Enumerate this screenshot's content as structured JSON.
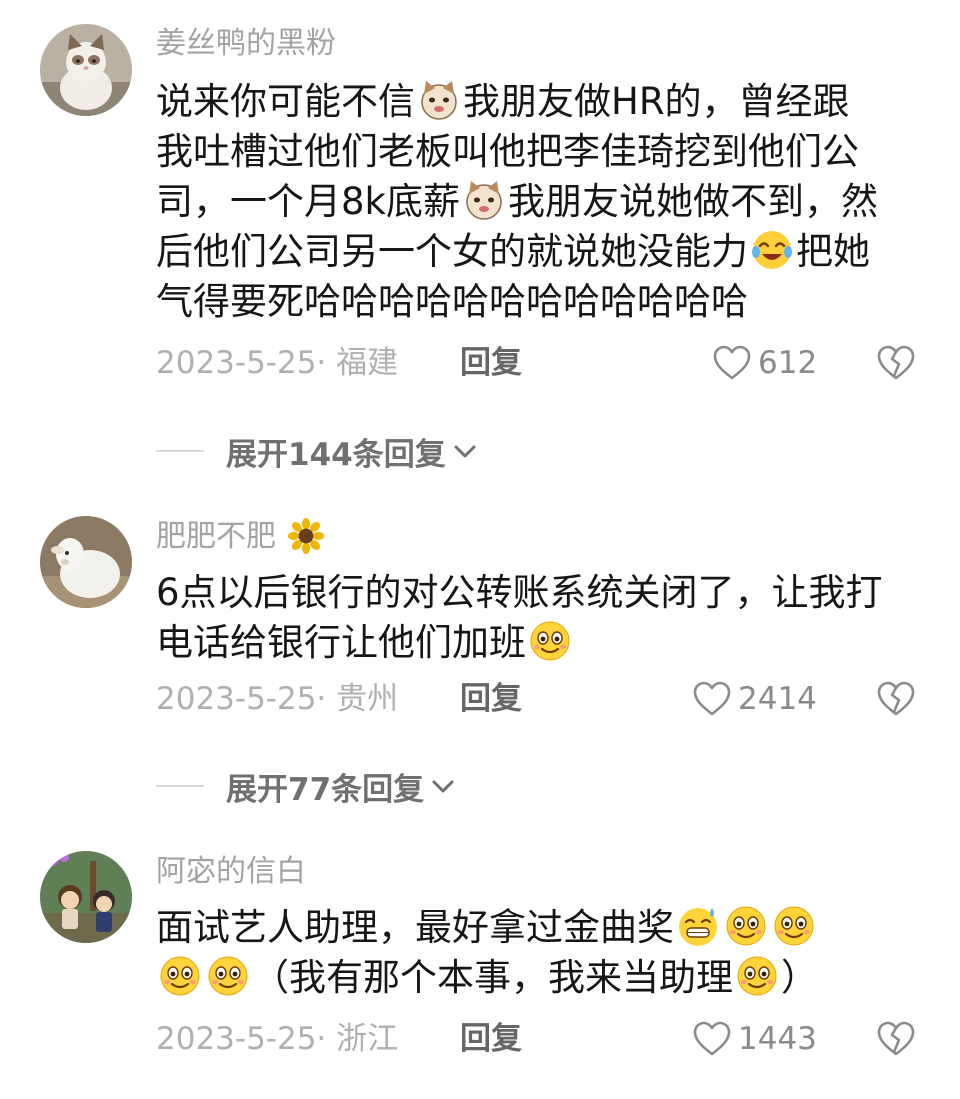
{
  "comments": [
    {
      "username": "姜丝鸭的黑粉",
      "lines": [
        [
          {
            "t": "说来你可能不信"
          },
          {
            "e": "cat"
          },
          {
            "t": "我朋友做HR的，曾经跟"
          }
        ],
        [
          {
            "t": "我吐槽过他们老板叫他把李佳琦挖到他们公"
          }
        ],
        [
          {
            "t": "司，一个月8k底薪"
          },
          {
            "e": "cat"
          },
          {
            "t": "我朋友说她做不到，然"
          }
        ],
        [
          {
            "t": "后他们公司另一个女的就说她没能力"
          },
          {
            "e": "laugh-cry"
          },
          {
            "t": "把她"
          }
        ],
        [
          {
            "t": "气得要死哈哈哈哈哈哈哈哈哈哈哈哈"
          }
        ]
      ],
      "date_location": "2023-5-25· 福建",
      "reply": "回复",
      "likes": "612",
      "expand": "展开144条回复"
    },
    {
      "username": "肥肥不肥",
      "username_emoji": "sunflower",
      "lines": [
        [
          {
            "t": "6点以后银行的对公转账系统关闭了，让我打"
          }
        ],
        [
          {
            "t": "电话给银行让他们加班"
          },
          {
            "e": "smile"
          }
        ]
      ],
      "date_location": "2023-5-25· 贵州",
      "reply": "回复",
      "likes": "2414",
      "expand": "展开77条回复"
    },
    {
      "username": "阿宓的信白",
      "lines": [
        [
          {
            "t": "面试艺人助理，最好拿过金曲奖"
          },
          {
            "e": "grin-sweat"
          },
          {
            "e": "smile"
          },
          {
            "e": "smile"
          }
        ],
        [
          {
            "e": "smile"
          },
          {
            "e": "smile"
          },
          {
            "t": "（我有那个本事，我来当助理"
          },
          {
            "e": "smile"
          },
          {
            "t": "）"
          }
        ]
      ],
      "date_location": "2023-5-25· 浙江",
      "reply": "回复",
      "likes": "1443"
    }
  ],
  "colors": {
    "username": "#a3a3a3",
    "body": "#161616",
    "meta": "#b0b0b0",
    "reply": "#666666",
    "expand": "#707070"
  },
  "icons": {
    "like": "heart-outline-icon",
    "dislike": "broken-heart-icon",
    "expand": "chevron-down-icon"
  }
}
